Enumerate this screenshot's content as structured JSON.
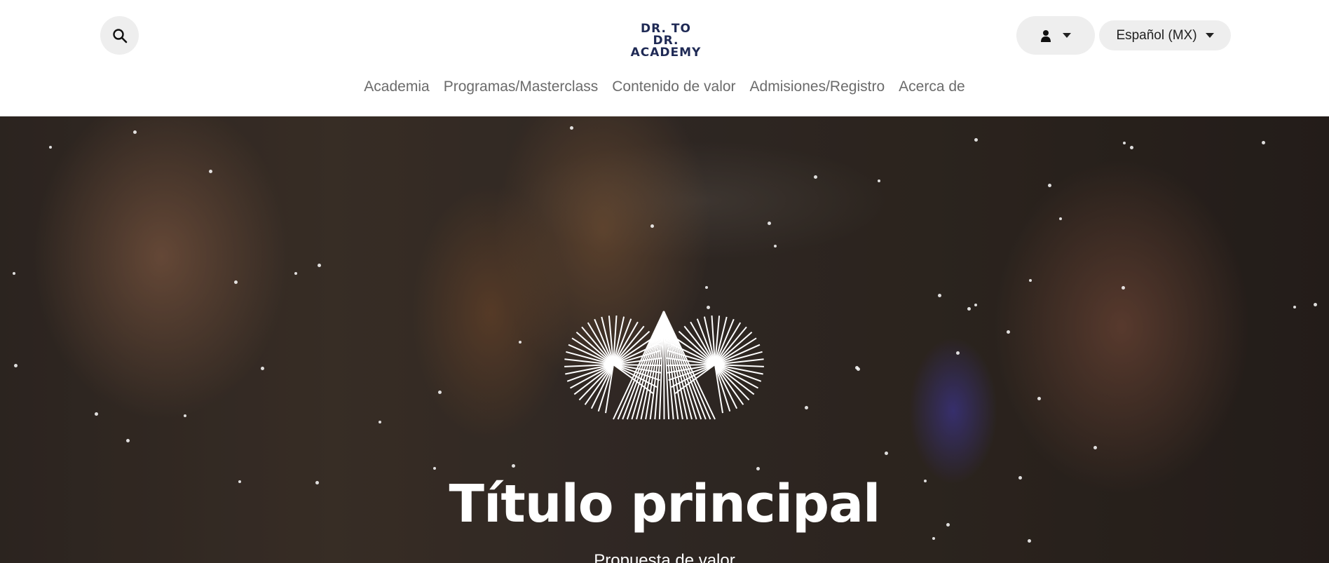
{
  "header": {
    "logo_line1": "DR. TO DR.",
    "logo_line2": "ACADEMY",
    "search_icon": "search-icon",
    "user_icon": "user-icon",
    "language_label": "Español (MX)"
  },
  "nav": {
    "items": [
      {
        "label": "Academia"
      },
      {
        "label": "Programas/Masterclass"
      },
      {
        "label": "Contenido de valor"
      },
      {
        "label": "Admisiones/Registro"
      },
      {
        "label": "Acerca de"
      }
    ]
  },
  "hero": {
    "title": "Título principal",
    "subtitle": "Propuesta de valor",
    "emblem_icon": "sunburst-emblem-icon"
  },
  "colors": {
    "brand_navy": "#1f2a55",
    "nav_text": "#6b6b6b",
    "pill_bg": "#eeeeee"
  }
}
